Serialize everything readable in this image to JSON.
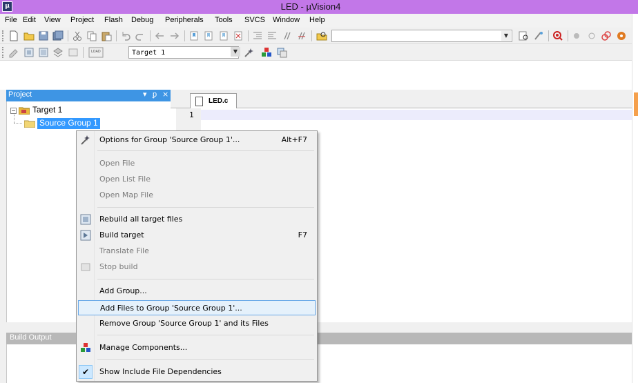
{
  "window": {
    "title": "LED  - µVision4",
    "app_icon": "uvision-logo-icon"
  },
  "menubar": {
    "items": [
      "File",
      "Edit",
      "View",
      "Project",
      "Flash",
      "Debug",
      "Peripherals",
      "Tools",
      "SVCS",
      "Window",
      "Help"
    ]
  },
  "toolbar2": {
    "target_value": "Target 1"
  },
  "project_panel": {
    "title": "Project",
    "controls": [
      "▾",
      "ᵱ",
      "×"
    ],
    "tree": {
      "root": "Target 1",
      "group": "Source Group 1"
    }
  },
  "editor": {
    "tab": "LED.c",
    "line_numbers": [
      "1"
    ]
  },
  "build_output": {
    "title": "Build Output"
  },
  "context_menu": {
    "items": [
      {
        "label": "Options for Group 'Source Group 1'...",
        "shortcut": "Alt+F7",
        "icon": "options-wand-icon",
        "enabled": true
      },
      {
        "label": "Open File",
        "enabled": false
      },
      {
        "label": "Open List File",
        "enabled": false
      },
      {
        "label": "Open Map File",
        "enabled": false
      },
      {
        "label": "Rebuild all target files",
        "icon": "rebuild-icon",
        "enabled": true
      },
      {
        "label": "Build target",
        "shortcut": "F7",
        "icon": "build-icon",
        "enabled": true
      },
      {
        "label": "Translate File",
        "enabled": false
      },
      {
        "label": "Stop build",
        "icon": "stop-build-icon",
        "enabled": false
      },
      {
        "label": "Add Group...",
        "enabled": true
      },
      {
        "label": "Add Files to Group 'Source Group 1'...",
        "enabled": true,
        "highlighted": true
      },
      {
        "label": "Remove Group 'Source Group 1' and its Files",
        "enabled": true
      },
      {
        "label": "Manage Components...",
        "icon": "components-icon",
        "enabled": true
      },
      {
        "label": "Show Include File Dependencies",
        "checked": true,
        "enabled": true
      }
    ]
  },
  "colors": {
    "titlebar": "#c277e8",
    "panel_header": "#3e95e4",
    "selection": "#3399ff",
    "highlight": "#e5f1fb"
  }
}
